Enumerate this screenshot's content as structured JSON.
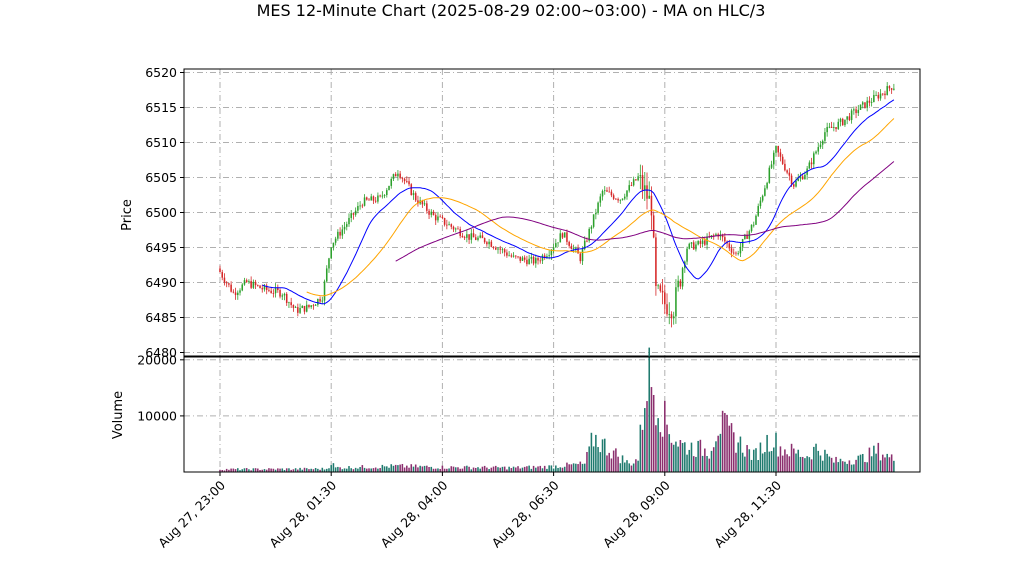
{
  "chart_data": {
    "type": "candlestick",
    "title": "MES 12-Minute Chart (2025-08-29 02:00~03:00) - MA on HLC/3",
    "price_panel": {
      "ylabel": "Price",
      "ylim": [
        6479.5,
        6520.5
      ],
      "yticks": [
        6480,
        6485,
        6490,
        6495,
        6500,
        6505,
        6510,
        6515,
        6520
      ]
    },
    "volume_panel": {
      "ylabel": "Volume",
      "ylim": [
        0,
        20500
      ],
      "yticks": [
        10000,
        20000
      ]
    },
    "x_tick_labels": [
      "Aug 27, 23:00",
      "Aug 28, 01:30",
      "Aug 28, 04:00",
      "Aug 28, 06:30",
      "Aug 28, 09:00",
      "Aug 28, 11:30"
    ],
    "x_tick_bar_index": [
      0,
      12.5,
      25,
      37.5,
      50,
      62.5
    ],
    "bars_per_tick_interval": 12.5,
    "grid": true,
    "colors": {
      "up": "#2ca02c",
      "down": "#d62728",
      "ma_fast": "#0000ff",
      "ma_mid": "#ffa500",
      "ma_slow": "#800080",
      "volume_up": "#1f7a6e",
      "volume_down": "#8b2f6e"
    },
    "close_anchors": [
      [
        0,
        6491.5
      ],
      [
        1.5,
        6488.5
      ],
      [
        3,
        6490
      ],
      [
        5,
        6489
      ],
      [
        7,
        6488.5
      ],
      [
        8.5,
        6486
      ],
      [
        10,
        6486.5
      ],
      [
        11.5,
        6488
      ],
      [
        12.5,
        6495.5
      ],
      [
        14,
        6498
      ],
      [
        16,
        6501.5
      ],
      [
        18,
        6502
      ],
      [
        20,
        6506
      ],
      [
        22,
        6502
      ],
      [
        24,
        6499.5
      ],
      [
        26,
        6498
      ],
      [
        28,
        6496.5
      ],
      [
        30,
        6496
      ],
      [
        33,
        6493.5
      ],
      [
        35.5,
        6493
      ],
      [
        37,
        6494.5
      ],
      [
        38.5,
        6497
      ],
      [
        40.5,
        6493.5
      ],
      [
        43,
        6503
      ],
      [
        45,
        6502
      ],
      [
        47,
        6505
      ],
      [
        48.5,
        6501
      ],
      [
        49,
        6488.5
      ],
      [
        50,
        6487
      ],
      [
        51,
        6486.5
      ],
      [
        52.5,
        6495
      ],
      [
        54,
        6495.5
      ],
      [
        56,
        6497
      ],
      [
        58,
        6494
      ],
      [
        60,
        6498.5
      ],
      [
        62.5,
        6509
      ],
      [
        64.5,
        6504
      ],
      [
        66,
        6506
      ],
      [
        68,
        6511.5
      ],
      [
        70,
        6513
      ],
      [
        72,
        6515
      ],
      [
        75.5,
        6518
      ]
    ],
    "volume_anchors": [
      [
        0,
        500
      ],
      [
        12,
        600
      ],
      [
        12.5,
        1800
      ],
      [
        13,
        800
      ],
      [
        20,
        1100
      ],
      [
        25,
        900
      ],
      [
        33,
        800
      ],
      [
        37,
        1000
      ],
      [
        41,
        1500
      ],
      [
        42,
        6500
      ],
      [
        46,
        1500
      ],
      [
        47,
        2500
      ],
      [
        48,
        18800
      ],
      [
        49,
        15000
      ],
      [
        50,
        9500
      ],
      [
        51,
        6500
      ],
      [
        52,
        5000
      ],
      [
        55,
        4000
      ],
      [
        56,
        9200
      ],
      [
        58,
        6000
      ],
      [
        60,
        3000
      ],
      [
        62,
        6500
      ],
      [
        63,
        4500
      ],
      [
        65,
        3500
      ],
      [
        66,
        3000
      ],
      [
        67,
        4500
      ],
      [
        69,
        2000
      ],
      [
        72,
        2500
      ],
      [
        74,
        4000
      ],
      [
        75.5,
        2500
      ]
    ],
    "ma_periods": {
      "ma_fast": 5,
      "ma_mid": 10,
      "ma_slow": 20
    },
    "bar_count": 76
  }
}
